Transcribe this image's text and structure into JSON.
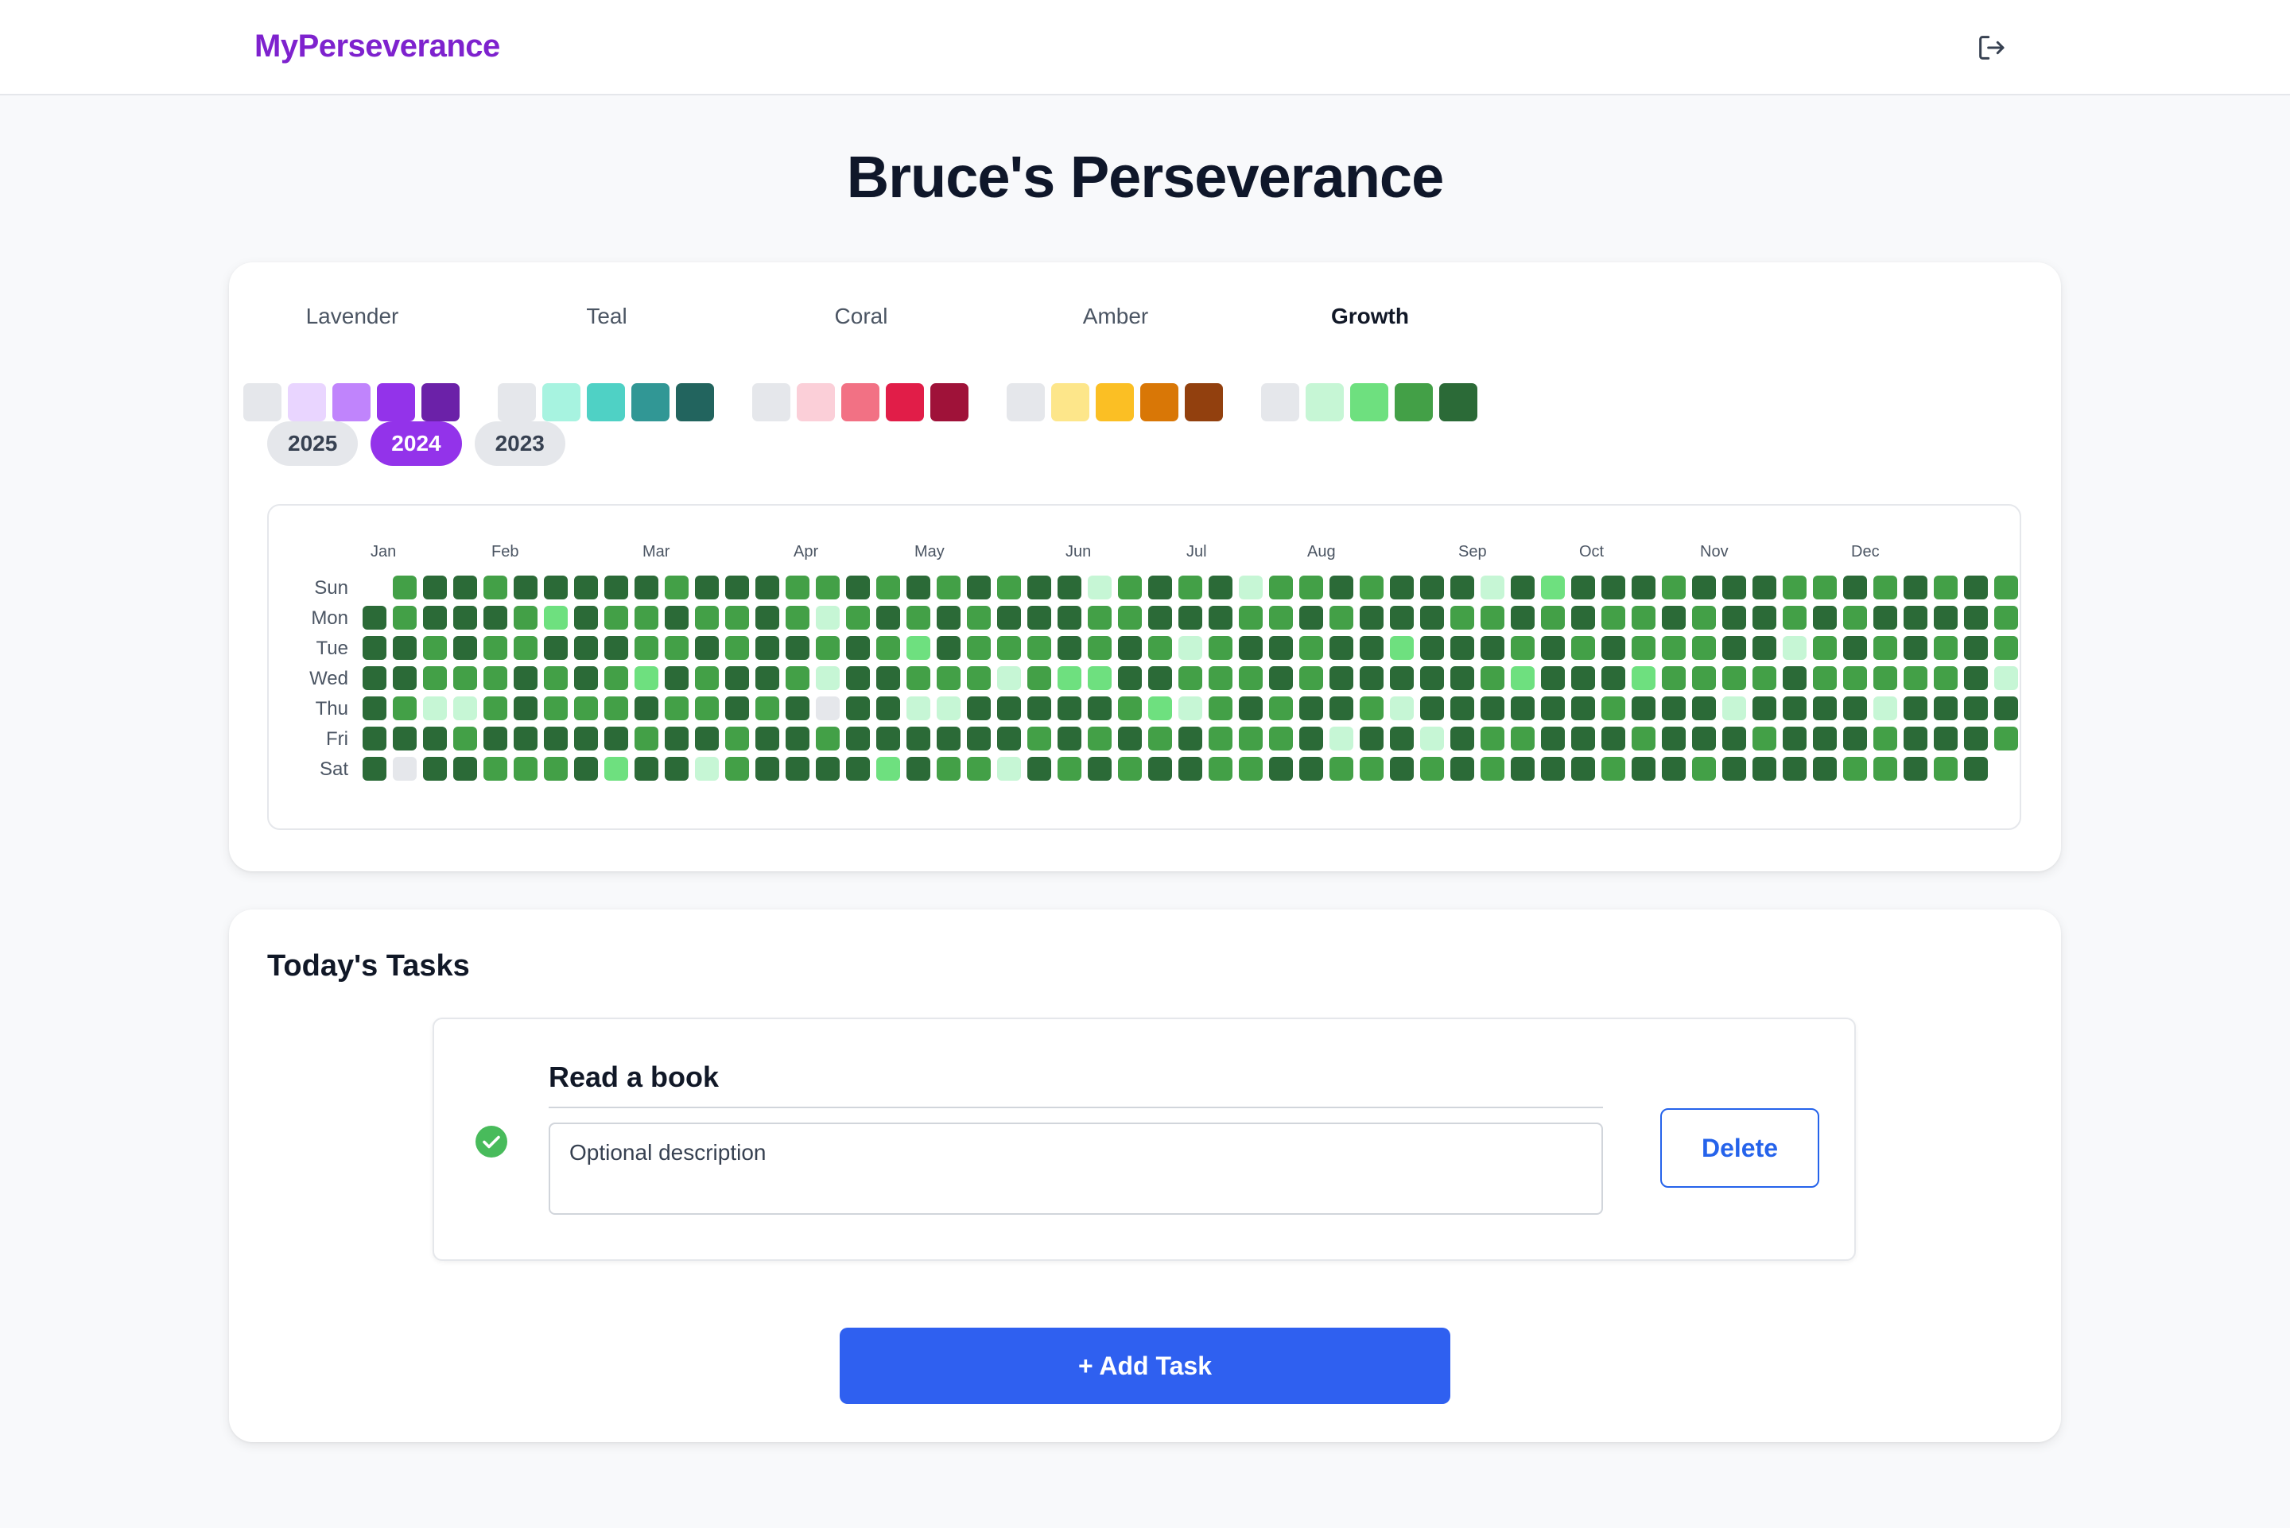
{
  "header": {
    "brand": "MyPerseverance",
    "logout_icon": "logout-icon"
  },
  "page": {
    "title": "Bruce's Perseverance"
  },
  "palettes": [
    {
      "name": "Lavender",
      "colors": [
        "#e5e7eb",
        "#e9d5ff",
        "#c084fc",
        "#9333ea",
        "#6b21a8"
      ]
    },
    {
      "name": "Teal",
      "colors": [
        "#e5e7eb",
        "#a7f3e0",
        "#4fd1c5",
        "#319795",
        "#22645e"
      ]
    },
    {
      "name": "Coral",
      "colors": [
        "#e5e7eb",
        "#fbcfd8",
        "#f27184",
        "#e11d48",
        "#9f1239"
      ]
    },
    {
      "name": "Amber",
      "colors": [
        "#e5e7eb",
        "#fde68a",
        "#fbbf24",
        "#d97706",
        "#92400e"
      ]
    },
    {
      "name": "Growth",
      "colors": [
        "#e5e7eb",
        "#c6f6d5",
        "#6ee07f",
        "#43a047",
        "#2b6a37"
      ],
      "selected": true
    }
  ],
  "years": [
    {
      "label": "2025",
      "active": false
    },
    {
      "label": "2024",
      "active": true
    },
    {
      "label": "2023",
      "active": false
    }
  ],
  "chart_data": {
    "type": "heatmap",
    "year": "2024",
    "months": [
      "Jan",
      "Feb",
      "Mar",
      "Apr",
      "May",
      "Jun",
      "Jul",
      "Aug",
      "Sep",
      "Oct",
      "Nov",
      "Dec"
    ],
    "month_start_week": [
      0,
      4,
      9,
      14,
      18,
      23,
      27,
      31,
      36,
      40,
      44,
      49
    ],
    "days": [
      "Sun",
      "Mon",
      "Tue",
      "Wed",
      "Thu",
      "Fri",
      "Sat"
    ],
    "start_day_index": 1,
    "levels_by_day": [
      "-3443444443444334343434413434133434441424443444334343433434444",
      "4344432433433431343434443344433434443343433434434344443-",
      "4434334443343443432433343431344344244434343334413434343-",
      "4433343432434431443331322443334344444324442333343333341-",
      "4311343334334340441144444321343443144444434441444414444-",
      "4443444443443443444444343434333414414334443444344434443-",
      "404433342441344442433143434433443343434443443444433434-"
    ]
  },
  "tasks": {
    "title": "Today's Tasks",
    "items": [
      {
        "name": "Read a book",
        "description_placeholder": "Optional description",
        "completed": true,
        "delete_label": "Delete"
      }
    ],
    "add_label": "+ Add Task"
  }
}
